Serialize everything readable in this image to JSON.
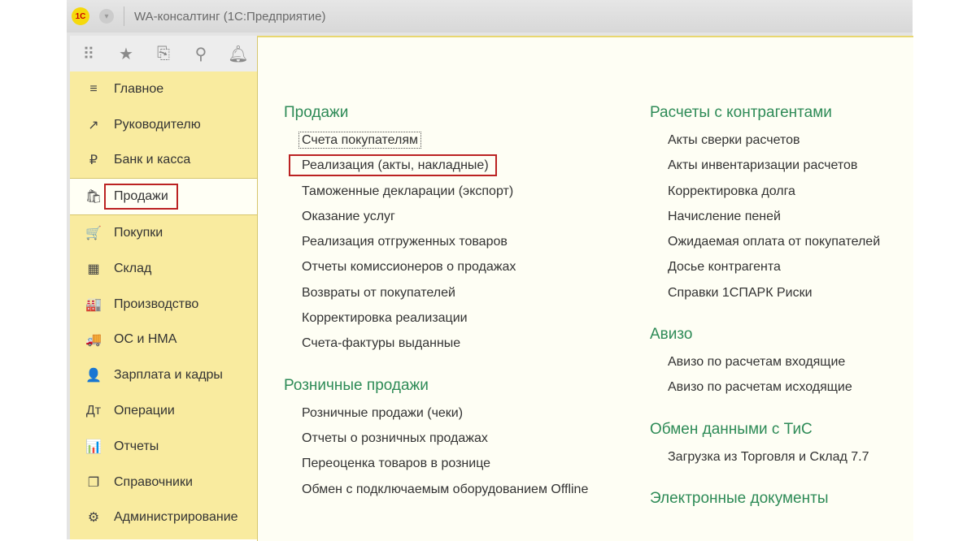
{
  "window": {
    "title": "WA-консалтинг  (1С:Предприятие)",
    "logo": "1С"
  },
  "toolbar": [
    "apps-icon",
    "star-icon",
    "history-icon",
    "search-icon",
    "bell-icon"
  ],
  "sidebar": {
    "items": [
      {
        "label": "Главное",
        "icon": "≡"
      },
      {
        "label": "Руководителю",
        "icon": "↗"
      },
      {
        "label": "Банк и касса",
        "icon": "₽"
      },
      {
        "label": "Продажи",
        "icon": "🛍"
      },
      {
        "label": "Покупки",
        "icon": "🛒"
      },
      {
        "label": "Склад",
        "icon": "▦"
      },
      {
        "label": "Производство",
        "icon": "🏭"
      },
      {
        "label": "ОС и НМА",
        "icon": "🚚"
      },
      {
        "label": "Зарплата и кадры",
        "icon": "👤"
      },
      {
        "label": "Операции",
        "icon": "Дт"
      },
      {
        "label": "Отчеты",
        "icon": "📊"
      },
      {
        "label": "Справочники",
        "icon": "❐"
      },
      {
        "label": "Администрирование",
        "icon": "⚙"
      }
    ]
  },
  "left": {
    "sales": {
      "title": "Продажи",
      "items": [
        "Счета покупателям",
        "Реализация (акты, накладные)",
        "Таможенные декларации (экспорт)",
        "Оказание услуг",
        "Реализация отгруженных товаров",
        "Отчеты комиссионеров о продажах",
        "Возвраты от покупателей",
        "Корректировка реализации",
        "Счета-фактуры выданные"
      ]
    },
    "retail": {
      "title": "Розничные продажи",
      "items": [
        "Розничные продажи (чеки)",
        "Отчеты о розничных продажах",
        "Переоценка товаров в рознице",
        "Обмен с подключаемым оборудованием Offline"
      ]
    }
  },
  "right": {
    "settlements": {
      "title": "Расчеты с контрагентами",
      "items": [
        "Акты сверки расчетов",
        "Акты инвентаризации расчетов",
        "Корректировка долга",
        "Начисление пеней",
        "Ожидаемая оплата от покупателей",
        "Досье контрагента",
        "Справки 1СПАРК Риски"
      ]
    },
    "aviso": {
      "title": "Авизо",
      "items": [
        "Авизо по расчетам входящие",
        "Авизо по расчетам исходящие"
      ]
    },
    "exchange": {
      "title": "Обмен данными с ТиС",
      "items": [
        "Загрузка из Торговля и Склад 7.7"
      ]
    },
    "edoc": {
      "title": "Электронные документы"
    }
  }
}
